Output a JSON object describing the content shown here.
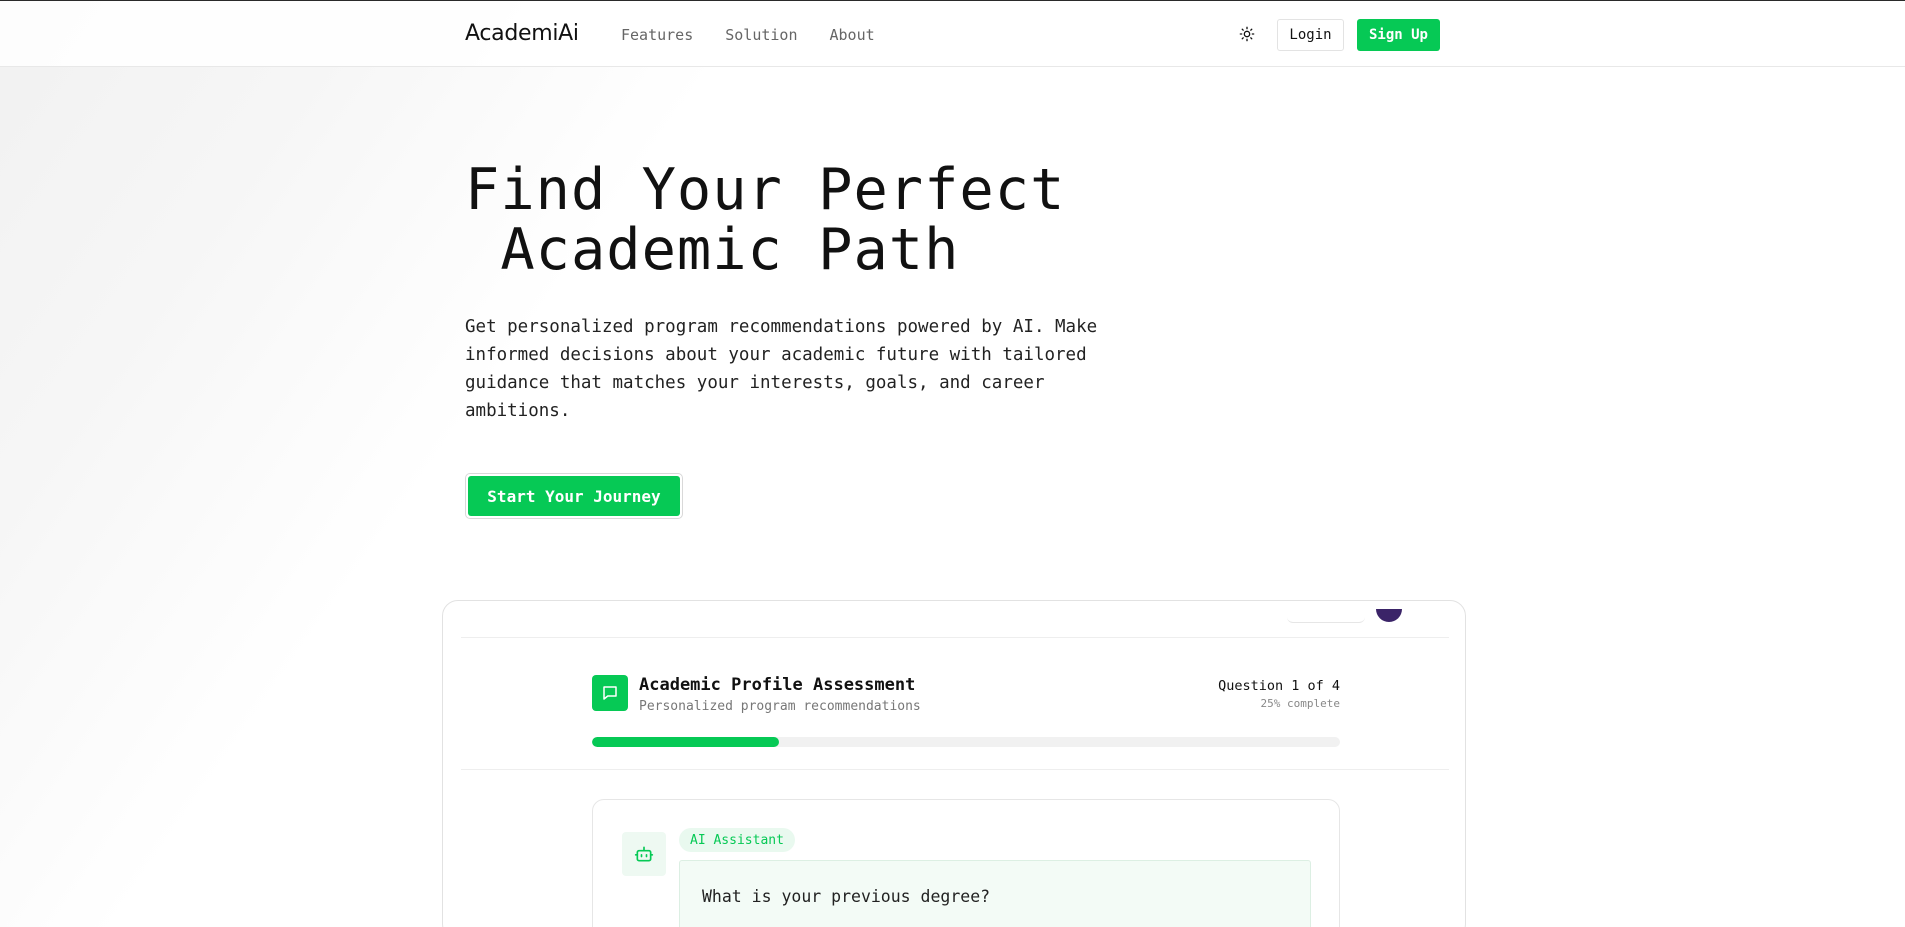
{
  "nav": {
    "logo": "AcademiAi",
    "links": [
      "Features",
      "Solution",
      "About"
    ],
    "theme_toggle_icon": "sun-icon",
    "login_label": "Login",
    "signup_label": "Sign Up"
  },
  "hero": {
    "title": "Find Your Perfect\n Academic Path",
    "description": "Get personalized program recommendations powered by AI. Make informed decisions about your academic future with tailored guidance that matches your interests, goals, and career ambitions.",
    "cta_label": "Start Your Journey"
  },
  "assessment": {
    "title": "Academic Profile Assessment",
    "subtitle": "Personalized program recommendations",
    "question_counter": "Question 1 of 4",
    "progress_text": "25% complete",
    "progress_fraction": 0.25,
    "icon": "chat-bubble-icon"
  },
  "chat": {
    "assistant_badge": "AI Assistant",
    "assistant_icon": "bot-icon",
    "question": "What is your previous degree?"
  },
  "colors": {
    "accent": "#06c955",
    "accent_soft": "#e9f9ef"
  }
}
